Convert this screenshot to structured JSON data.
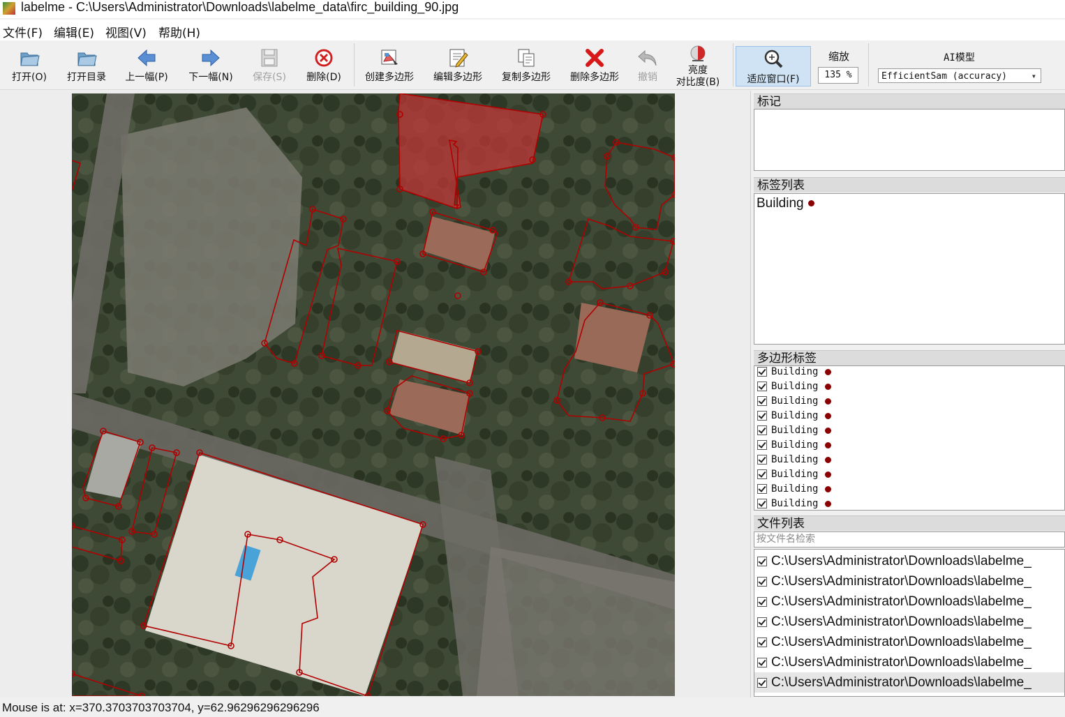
{
  "window": {
    "title": "labelme - C:\\Users\\Administrator\\Downloads\\labelme_data\\firc_building_90.jpg"
  },
  "menu": {
    "file": "文件(F)",
    "edit": "编辑(E)",
    "view": "视图(V)",
    "help": "帮助(H)"
  },
  "toolbar": {
    "open": "打开(O)",
    "open_dir": "打开目录",
    "prev": "上一幅(P)",
    "next": "下一幅(N)",
    "save": "保存(S)",
    "delete": "删除(D)",
    "create_polygon": "创建多边形",
    "edit_polygon": "编辑多边形",
    "copy_polygon": "复制多边形",
    "delete_polygon": "删除多边形",
    "undo": "撤销",
    "brightness_line1": "亮度",
    "brightness_line2": "对比度(B)",
    "fit_window": "适应窗口(F)",
    "zoom_label": "缩放",
    "zoom_value": "135 %",
    "ai_label": "AI模型",
    "ai_model": "EfficientSam (accuracy)"
  },
  "panels": {
    "flags_title": "标记",
    "labels_title": "标签列表",
    "labels": [
      "Building"
    ],
    "polygons_title": "多边形标签",
    "polygons": [
      "Building",
      "Building",
      "Building",
      "Building",
      "Building",
      "Building",
      "Building",
      "Building",
      "Building",
      "Building"
    ],
    "files_title": "文件列表",
    "file_search_placeholder": "按文件名检索",
    "files": [
      "C:\\Users\\Administrator\\Downloads\\labelme_",
      "C:\\Users\\Administrator\\Downloads\\labelme_",
      "C:\\Users\\Administrator\\Downloads\\labelme_",
      "C:\\Users\\Administrator\\Downloads\\labelme_",
      "C:\\Users\\Administrator\\Downloads\\labelme_",
      "C:\\Users\\Administrator\\Downloads\\labelme_",
      "C:\\Users\\Administrator\\Downloads\\labelme_"
    ]
  },
  "colors": {
    "label": "#8b0000",
    "polygon_stroke": "#b00000",
    "polygon_fill_selected": "#c03838"
  },
  "status": {
    "text": "Mouse is at: x=370.3703703703704, y=62.96296296296296"
  }
}
